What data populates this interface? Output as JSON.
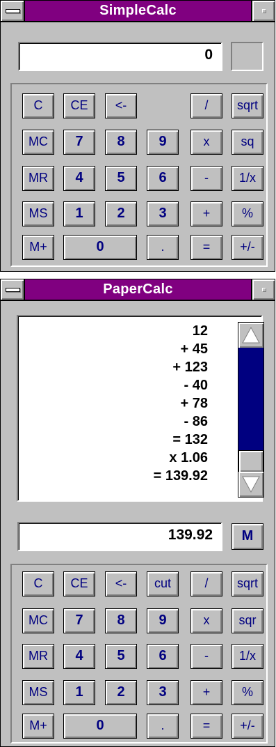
{
  "simplecalc": {
    "title": "SimpleCalc",
    "display_value": "0",
    "buttons": {
      "c": "C",
      "ce": "CE",
      "backspace": "<-",
      "divide": "/",
      "sqrt": "sqrt",
      "mc": "MC",
      "n7": "7",
      "n8": "8",
      "n9": "9",
      "multiply": "x",
      "sq": "sq",
      "mr": "MR",
      "n4": "4",
      "n5": "5",
      "n6": "6",
      "minus": "-",
      "reciprocal": "1/x",
      "ms": "MS",
      "n1": "1",
      "n2": "2",
      "n3": "3",
      "plus": "+",
      "percent": "%",
      "mplus": "M+",
      "n0": "0",
      "decimal": ".",
      "equals": "=",
      "sign": "+/-"
    }
  },
  "papercalc": {
    "title": "PaperCalc",
    "tape": [
      "12",
      "+ 45",
      "+ 123",
      "- 40",
      "+ 78",
      "- 86",
      "= 132",
      "x 1.06",
      "= 139.92"
    ],
    "display_value": "139.92",
    "memory_indicator": "M",
    "buttons": {
      "c": "C",
      "ce": "CE",
      "backspace": "<-",
      "cut": "cut",
      "divide": "/",
      "sqrt": "sqrt",
      "mc": "MC",
      "n7": "7",
      "n8": "8",
      "n9": "9",
      "multiply": "x",
      "sqr": "sqr",
      "mr": "MR",
      "n4": "4",
      "n5": "5",
      "n6": "6",
      "minus": "-",
      "reciprocal": "1/x",
      "ms": "MS",
      "n1": "1",
      "n2": "2",
      "n3": "3",
      "plus": "+",
      "percent": "%",
      "mplus": "M+",
      "n0": "0",
      "decimal": ".",
      "equals": "=",
      "sign": "+/-"
    }
  },
  "colors": {
    "titlebar": "#800080",
    "face": "#c0c0c0",
    "button_text": "#000080",
    "scrollbar_track": "#000080"
  }
}
